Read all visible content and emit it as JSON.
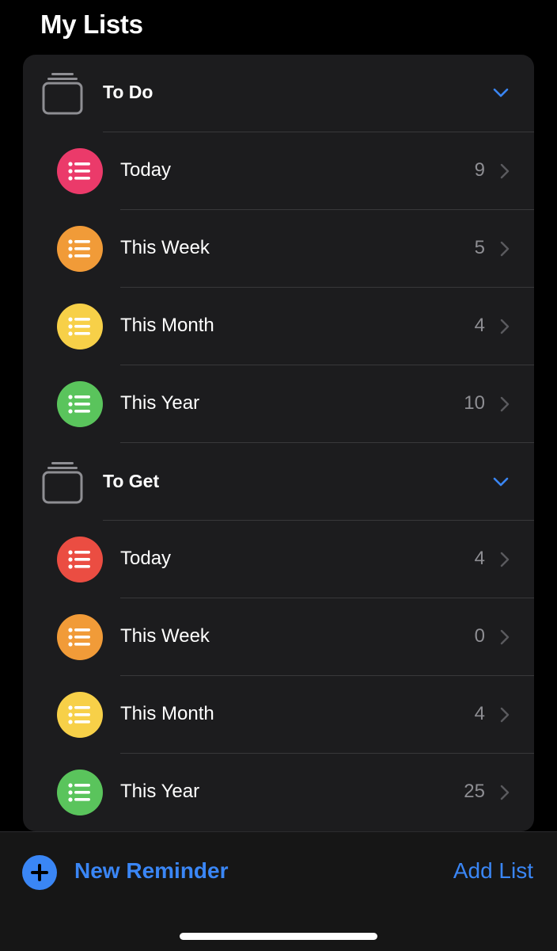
{
  "header": {
    "title": "My Lists"
  },
  "groups": [
    {
      "title": "To Do",
      "icon": "stacked-folder-icon",
      "expanded": true,
      "lists": [
        {
          "label": "Today",
          "count": "9",
          "color": "#eb3a6a"
        },
        {
          "label": "This Week",
          "count": "5",
          "color": "#f19b38"
        },
        {
          "label": "This Month",
          "count": "4",
          "color": "#f7d048"
        },
        {
          "label": "This Year",
          "count": "10",
          "color": "#5ac45c"
        }
      ]
    },
    {
      "title": "To Get",
      "icon": "stacked-folder-icon",
      "expanded": true,
      "lists": [
        {
          "label": "Today",
          "count": "4",
          "color": "#eb4d42"
        },
        {
          "label": "This Week",
          "count": "0",
          "color": "#f19b38"
        },
        {
          "label": "This Month",
          "count": "4",
          "color": "#f7d048"
        },
        {
          "label": "This Year",
          "count": "25",
          "color": "#5ac45c"
        }
      ]
    }
  ],
  "toolbar": {
    "new_reminder_label": "New Reminder",
    "add_list_label": "Add List"
  },
  "colors": {
    "accent": "#3a86f5",
    "background": "#000000",
    "card": "#1c1c1e",
    "secondary_text": "#8e8e93"
  }
}
